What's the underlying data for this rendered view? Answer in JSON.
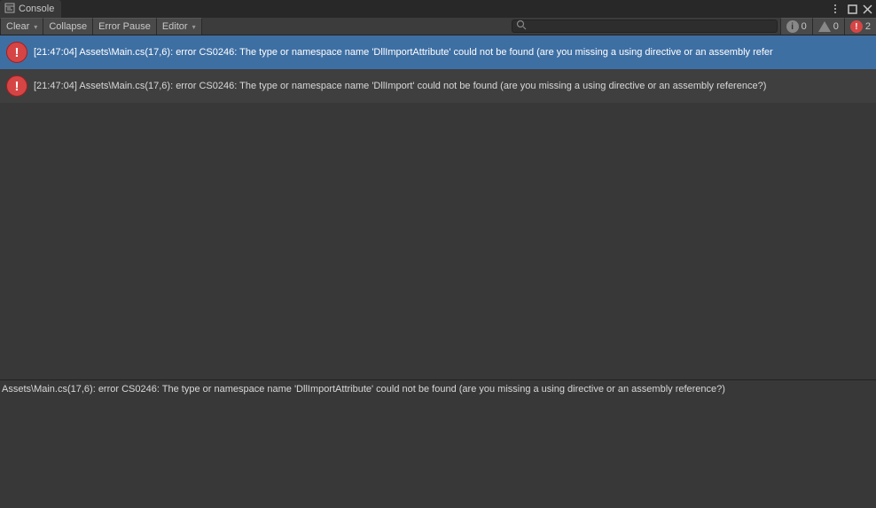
{
  "tab": {
    "title": "Console"
  },
  "toolbar": {
    "clear": "Clear",
    "collapse": "Collapse",
    "error_pause": "Error Pause",
    "editor": "Editor",
    "search_placeholder": ""
  },
  "counts": {
    "info": "0",
    "warn": "0",
    "error": "2"
  },
  "logs": [
    {
      "text": "[21:47:04] Assets\\Main.cs(17,6): error CS0246: The type or namespace name 'DllImportAttribute' could not be found (are you missing a using directive or an assembly refer"
    },
    {
      "text": "[21:47:04] Assets\\Main.cs(17,6): error CS0246: The type or namespace name 'DllImport' could not be found (are you missing a using directive or an assembly reference?)"
    }
  ],
  "detail": "Assets\\Main.cs(17,6): error CS0246: The type or namespace name 'DllImportAttribute' could not be found (are you missing a using directive or an assembly reference?)"
}
